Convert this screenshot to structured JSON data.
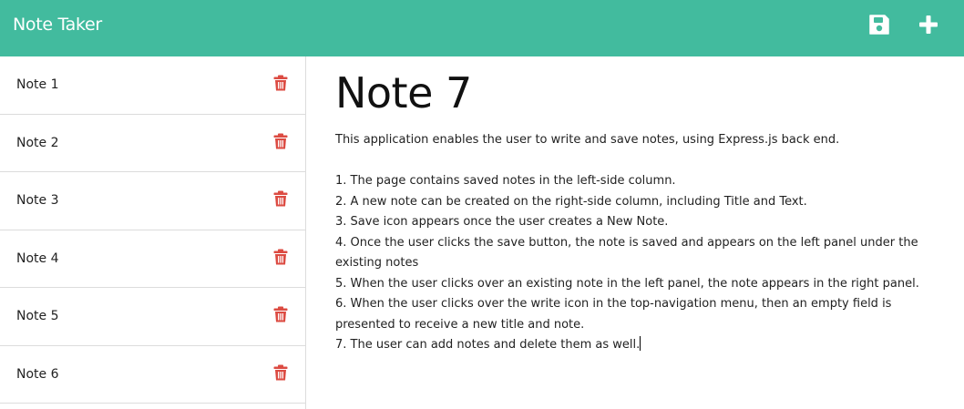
{
  "colors": {
    "accent": "#42bb9e",
    "trash": "#dc4b42"
  },
  "header": {
    "brand": "Note Taker",
    "save_icon": "floppy-disk-icon",
    "new_icon": "plus-icon"
  },
  "sidebar": {
    "items": [
      {
        "title": "Note 1",
        "icon": "trash-icon"
      },
      {
        "title": "Note 2",
        "icon": "trash-icon"
      },
      {
        "title": "Note 3",
        "icon": "trash-icon"
      },
      {
        "title": "Note 4",
        "icon": "trash-icon"
      },
      {
        "title": "Note 5",
        "icon": "trash-icon"
      },
      {
        "title": "Note 6",
        "icon": "trash-icon"
      }
    ]
  },
  "editor": {
    "title": "Note 7",
    "text": "This application enables the user to write and save notes, using Express.js back end.\n\n1. The page contains saved notes in the left-side column.\n2. A new note can be created on the right-side column, including Title and Text.\n3. Save icon appears once the user creates a New Note.\n4. Once the user clicks the save button, the note is saved and appears on the left panel under the existing notes\n5. When the user clicks over an existing note in the left panel, the note appears in the right panel.\n6. When the user clicks over the write icon in the top-navigation menu, then an empty field is presented to receive a new title and note.\n7. The user can add notes and delete them as well."
  }
}
